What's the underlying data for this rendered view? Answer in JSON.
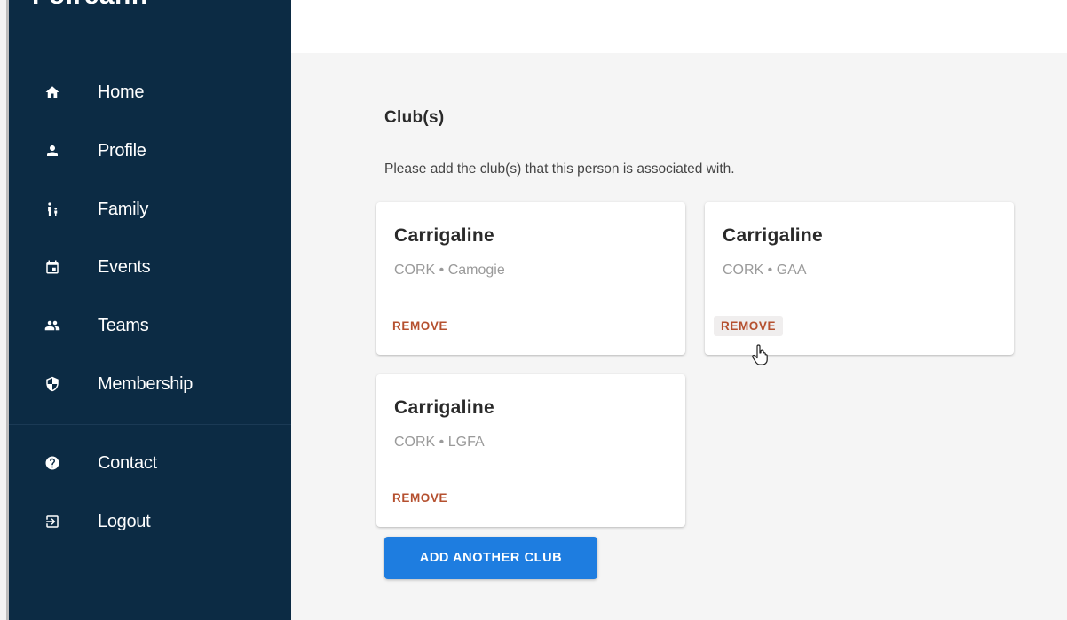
{
  "brand": {
    "name": "Foireann"
  },
  "sidebar": {
    "items": [
      {
        "label": "Home",
        "icon": "home-icon"
      },
      {
        "label": "Profile",
        "icon": "person-icon"
      },
      {
        "label": "Family",
        "icon": "family-icon"
      },
      {
        "label": "Events",
        "icon": "calendar-icon"
      },
      {
        "label": "Teams",
        "icon": "group-icon"
      },
      {
        "label": "Membership",
        "icon": "shield-icon"
      },
      {
        "label": "Contact",
        "icon": "help-icon"
      },
      {
        "label": "Logout",
        "icon": "logout-icon"
      }
    ]
  },
  "clubs_section": {
    "title": "Club(s)",
    "description": "Please add the club(s) that this person is associated with.",
    "clubs": [
      {
        "name": "Carrigaline",
        "details": "CORK • Camogie",
        "remove_label": "REMOVE"
      },
      {
        "name": "Carrigaline",
        "details": "CORK • GAA",
        "remove_label": "REMOVE"
      },
      {
        "name": "Carrigaline",
        "details": "CORK • LGFA",
        "remove_label": "REMOVE"
      }
    ],
    "add_button_label": "ADD ANOTHER CLUB"
  },
  "colors": {
    "sidebar_bg": "#0c2b44",
    "remove_text": "#b5502f",
    "primary_button": "#1e7de0",
    "content_bg": "#f5f5f5"
  }
}
